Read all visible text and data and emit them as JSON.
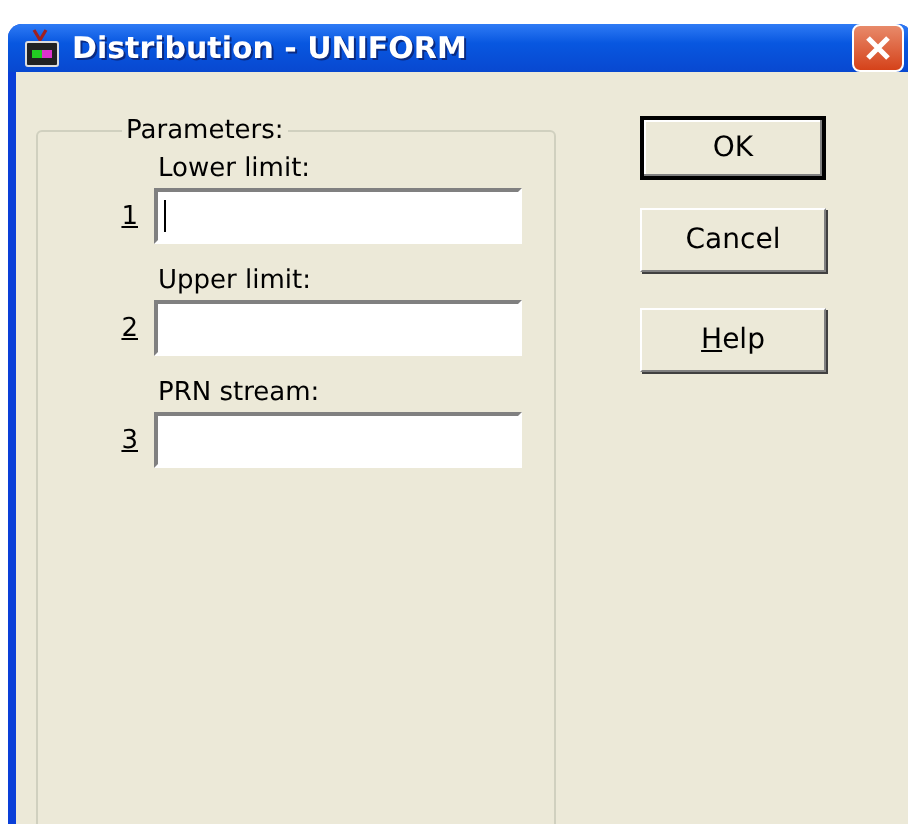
{
  "window": {
    "title": "Distribution - UNIFORM"
  },
  "parameters": {
    "title": "Parameters:",
    "fields": [
      {
        "number": "1",
        "label": "Lower limit:",
        "focused": true
      },
      {
        "number": "2",
        "label": "Upper limit:",
        "focused": false
      },
      {
        "number": "3",
        "label": "PRN stream:",
        "focused": false
      }
    ]
  },
  "buttons": [
    {
      "label": "OK",
      "default": true,
      "first_letter_underlined": false
    },
    {
      "label": "Cancel",
      "default": false,
      "first_letter_underlined": false
    },
    {
      "label": "Help",
      "default": false,
      "first_letter_underlined": true
    }
  ]
}
